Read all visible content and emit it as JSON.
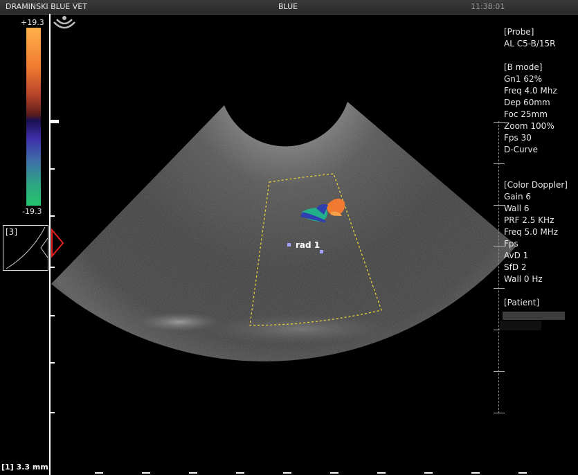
{
  "topbar": {
    "brand": "DRAMINSKI BLUE VET",
    "mode": "BLUE",
    "clock": "11:38:01"
  },
  "colorscale": {
    "max_label": "+19.3",
    "min_label": "-19.3"
  },
  "thumbnail": {
    "label": "[3]"
  },
  "measurement": {
    "label": "rad 1",
    "readout": "[1] 3.3 mm;"
  },
  "probe": {
    "header": "[Probe]",
    "name": "AL C5-B/15R"
  },
  "bmode": {
    "header": "[B mode]",
    "lines": [
      "Gn1 62%",
      "Freq 4.0 Mhz",
      "Dep 60mm",
      "Foc 25mm",
      "Zoom 100%",
      "Fps 30",
      "D-Curve"
    ]
  },
  "color_doppler": {
    "header": "[Color Doppler]",
    "lines": [
      "Gain 6",
      "Wall 6",
      "PRF 2.5 KHz",
      "Freq 5.0 MHz",
      "Fps",
      "AvD 1",
      "SfD 2",
      "Wall 0 Hz"
    ]
  },
  "patient": {
    "header": "[Patient]"
  },
  "colors": {
    "roi_outline": "#e6d23a",
    "doppler_red": "#f07b30",
    "doppler_blue": "#2f3fb0",
    "doppler_green": "#22b08a"
  }
}
